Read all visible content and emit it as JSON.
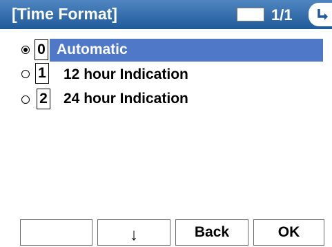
{
  "header": {
    "title": "[Time Format]",
    "page_count": "1/1",
    "scroll_icon": "scroll-tab-icon"
  },
  "options": [
    {
      "key": "0",
      "label": "Automatic",
      "selected": true
    },
    {
      "key": "1",
      "label": "12 hour Indication",
      "selected": false
    },
    {
      "key": "2",
      "label": "24 hour Indication",
      "selected": false
    }
  ],
  "softkeys": {
    "key1": "",
    "key2": "↓",
    "key3": "Back",
    "key4": "OK"
  },
  "colors": {
    "title_bar": "#2f6aab",
    "selection": "#5078c8"
  }
}
